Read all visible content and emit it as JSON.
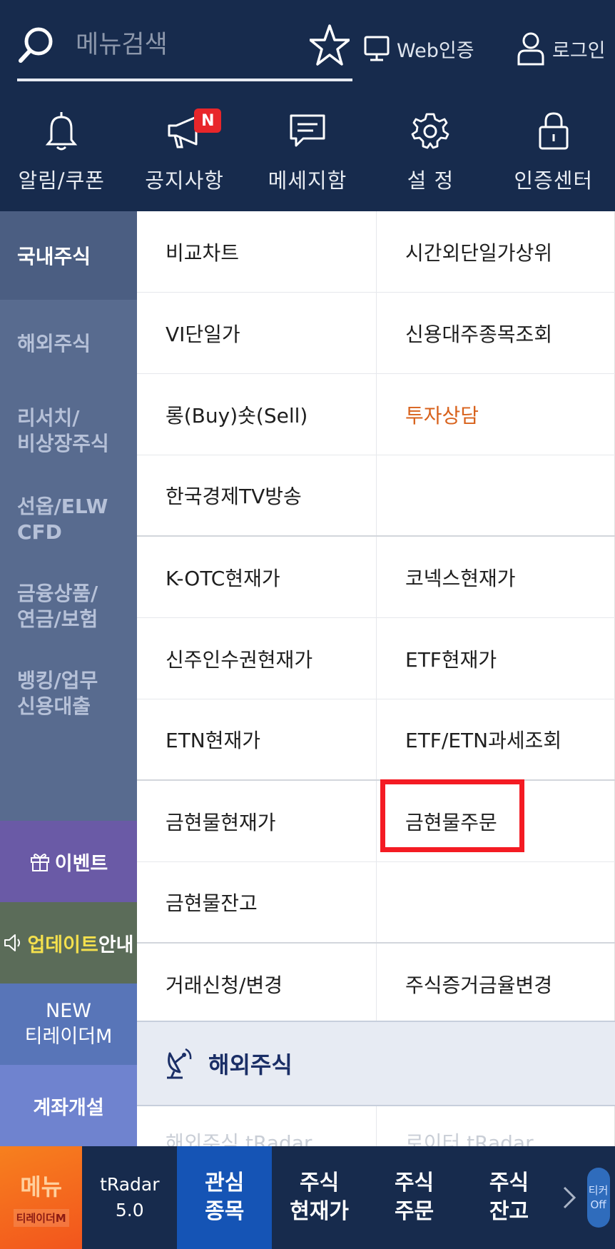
{
  "header": {
    "search": {
      "placeholder": "메뉴검색"
    },
    "web_cert_label": "Web인증",
    "login_label": "로그인",
    "quick_menu": [
      {
        "label": "알림/쿠폰",
        "icon": "bell-icon"
      },
      {
        "label": "공지사항",
        "icon": "megaphone-icon",
        "badge": "N"
      },
      {
        "label": "메세지함",
        "icon": "message-icon"
      },
      {
        "label": "설 정",
        "icon": "gear-icon"
      },
      {
        "label": "인증센터",
        "icon": "lock-icon"
      }
    ]
  },
  "sidebar": {
    "active": "국내주식",
    "items": [
      {
        "label": "해외주식"
      },
      {
        "label": "리서치/\n비상장주식"
      },
      {
        "label": "선옵/ELW\nCFD"
      },
      {
        "label": "금융상품/\n연금/보험"
      },
      {
        "label": "뱅킹/업무\n신용대출"
      }
    ],
    "event_label": "이벤트",
    "update_label_highlight": "업데이트",
    "update_label_rest": "안내",
    "new_label_1": "NEW",
    "new_label_2": "티레이더M",
    "account_label": "계좌개설"
  },
  "menu_grid": {
    "rows": [
      [
        "비교차트",
        "시간외단일가상위"
      ],
      [
        "VI단일가",
        "신용대주종목조회"
      ],
      [
        "롱(Buy)숏(Sell)",
        "투자상담"
      ],
      [
        "한국경제TV방송",
        ""
      ],
      [
        "K-OTC현재가",
        "코넥스현재가"
      ],
      [
        "신주인수권현재가",
        "ETF현재가"
      ],
      [
        "ETN현재가",
        "ETF/ETN과세조회"
      ],
      [
        "금현물현재가",
        "금현물주문"
      ],
      [
        "금현물잔고",
        ""
      ],
      [
        "거래신청/변경",
        "주식증거금율변경"
      ]
    ],
    "orange_item": "투자상담",
    "highlighted_item": "금현물주문"
  },
  "section": {
    "title": "해외주식",
    "partial_items": [
      "해외주식 tRadar",
      "로이터 tRadar"
    ]
  },
  "bottom_bar": {
    "menu_label": "메뉴",
    "menu_sub": "티레이더M",
    "tabs": [
      {
        "line1": "tRadar",
        "line2": "5.0"
      },
      {
        "line1": "관심",
        "line2": "종목"
      },
      {
        "line1": "주식",
        "line2": "현재가"
      },
      {
        "line1": "주식",
        "line2": "주문"
      },
      {
        "line1": "주식",
        "line2": "잔고"
      }
    ],
    "ticker_line1": "티커",
    "ticker_line2": "Off"
  },
  "colors": {
    "header_bg": "#172b4d",
    "sidebar_bg": "#586b8f",
    "active_tab_bg": "#1554b5",
    "orange_text": "#d8621c",
    "highlight_border": "#f41b23",
    "badge_red": "#e8262a"
  }
}
